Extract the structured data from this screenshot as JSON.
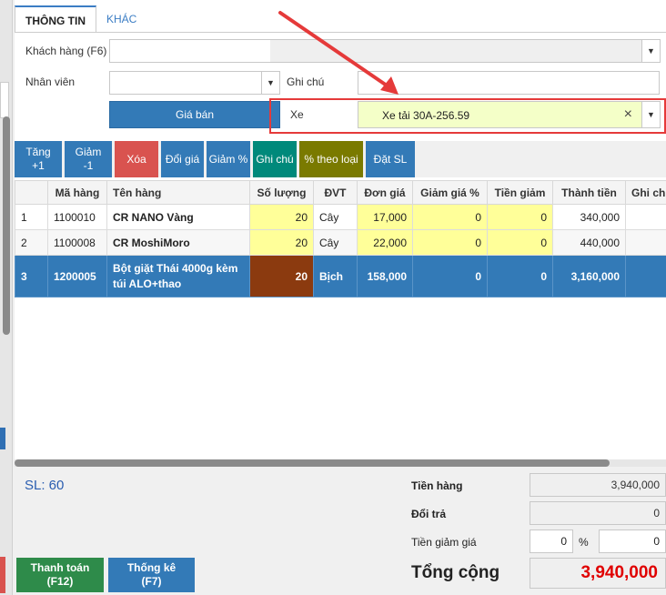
{
  "tabs": [
    {
      "label": "THÔNG TIN",
      "active": true
    },
    {
      "label": "KHÁC",
      "active": false
    }
  ],
  "form": {
    "customer_label": "Khách hàng (F6)",
    "customer_value": "",
    "staff_label": "Nhân viên",
    "staff_value": "",
    "note_label": "Ghi chú",
    "note_value": "",
    "price_button": "Giá bán",
    "vehicle_label": "Xe",
    "vehicle_value": "Xe tải 30A-256.59",
    "clear_glyph": "×"
  },
  "toolbar": [
    {
      "line1": "Tăng",
      "line2": "+1",
      "color": "#337ab7"
    },
    {
      "line1": "Giảm",
      "line2": "-1",
      "color": "#337ab7"
    },
    {
      "line1": "Xóa",
      "line2": "",
      "color": "#d9534f"
    },
    {
      "line1": "Đổi giá",
      "line2": "",
      "color": "#337ab7"
    },
    {
      "line1": "Giảm %",
      "line2": "",
      "color": "#337ab7"
    },
    {
      "line1": "Ghi chú",
      "line2": "",
      "color": "#00897b"
    },
    {
      "line1": "% theo loại",
      "line2": "",
      "color": "#7a7a00"
    },
    {
      "line1": "Đặt SL",
      "line2": "",
      "color": "#337ab7"
    }
  ],
  "table": {
    "headers": [
      "",
      "Mã hàng",
      "Tên hàng",
      "Số lượng",
      "ĐVT",
      "Đơn giá",
      "Giảm giá %",
      "Tiền giảm",
      "Thành tiền",
      "Ghi chú"
    ],
    "rows": [
      [
        "1",
        "1100010",
        "CR NANO Vàng",
        "20",
        "Cây",
        "17,000",
        "0",
        "0",
        "340,000",
        ""
      ],
      [
        "2",
        "1100008",
        "CR MoshiMoro",
        "20",
        "Cây",
        "22,000",
        "0",
        "0",
        "440,000",
        ""
      ],
      [
        "3",
        "1200005",
        "Bột giặt Thái 4000g kèm túi ALO+thao",
        "20",
        "Bịch",
        "158,000",
        "0",
        "0",
        "3,160,000",
        ""
      ]
    ]
  },
  "footer": {
    "sl": "SL: 60",
    "goods_label": "Tiền hàng",
    "goods_value": "3,940,000",
    "return_label": "Đổi trả",
    "return_value": "0",
    "discount_label": "Tiền giảm giá",
    "discount_percent": "0",
    "percent_sign": "%",
    "discount_amount": "0",
    "total_label": "Tổng cộng",
    "total_value": "3,940,000",
    "pay_line1": "Thanh toán",
    "pay_line2": "(F12)",
    "stats_line1": "Thống kê",
    "stats_line2": "(F7)"
  },
  "colors": {
    "accent": "#337ab7",
    "pay": "#2e8b4a",
    "total": "#e00000",
    "annotation": "#e53a3a"
  }
}
